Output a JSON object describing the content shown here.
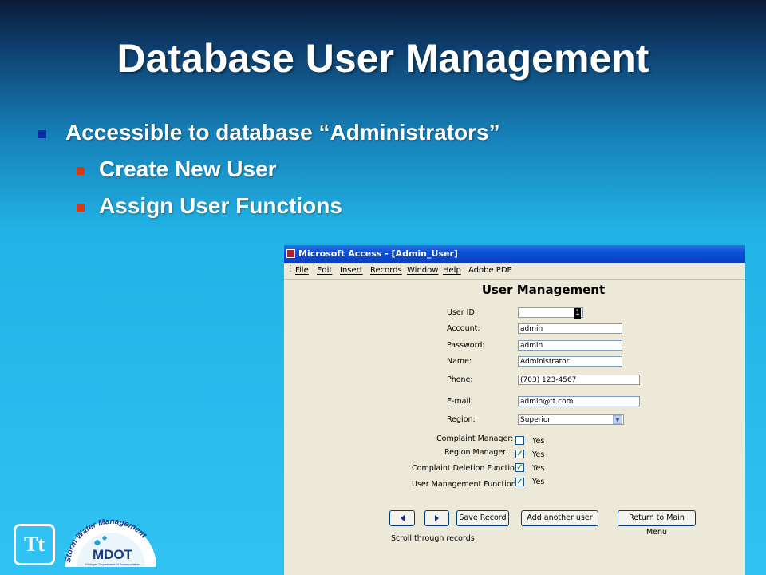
{
  "slide": {
    "title": "Database User Management",
    "bullets": [
      "Accessible to database “Administrators”",
      "Create New User",
      "Assign User Functions"
    ]
  },
  "window": {
    "title": "Microsoft Access - [Admin_User]",
    "menu": [
      "File",
      "Edit",
      "Insert",
      "Records",
      "Window",
      "Help",
      "Adobe PDF"
    ]
  },
  "form": {
    "title": "User Management",
    "fields": {
      "user_id": {
        "label": "User ID:",
        "value": "1"
      },
      "account": {
        "label": "Account:",
        "value": "admin"
      },
      "password": {
        "label": "Password:",
        "value": "admin"
      },
      "name": {
        "label": "Name:",
        "value": "Administrator"
      },
      "phone": {
        "label": "Phone:",
        "value": "(703) 123-4567"
      },
      "email": {
        "label": "E-mail:",
        "value": "admin@tt.com"
      },
      "region": {
        "label": "Region:",
        "value": "Superior"
      }
    },
    "checks": {
      "complaint_manager": {
        "label": "Complaint Manager:",
        "checked": false,
        "text": "Yes"
      },
      "region_manager": {
        "label": "Region Manager:",
        "checked": true,
        "text": "Yes"
      },
      "complaint_deletion": {
        "label": "Complaint Deletion Function:",
        "checked": true,
        "text": "Yes"
      },
      "user_mgmt": {
        "label": "User Management Function:",
        "checked": true,
        "text": "Yes"
      }
    },
    "buttons": {
      "save": "Save Record",
      "add": "Add another user",
      "return": "Return to Main Menu"
    },
    "scroll_hint": "Scroll through records"
  },
  "logos": {
    "tt": "Tt",
    "swm_top": "Storm Water Management",
    "swm_main": "MDOT",
    "swm_sub": "Michigan Department of Transportation"
  },
  "colors": {
    "bullet_level1": "#0a2aa8",
    "bullet_level2": "#d63a10",
    "titlebar": "#0a4fd6",
    "check_mark": "#21a121"
  }
}
